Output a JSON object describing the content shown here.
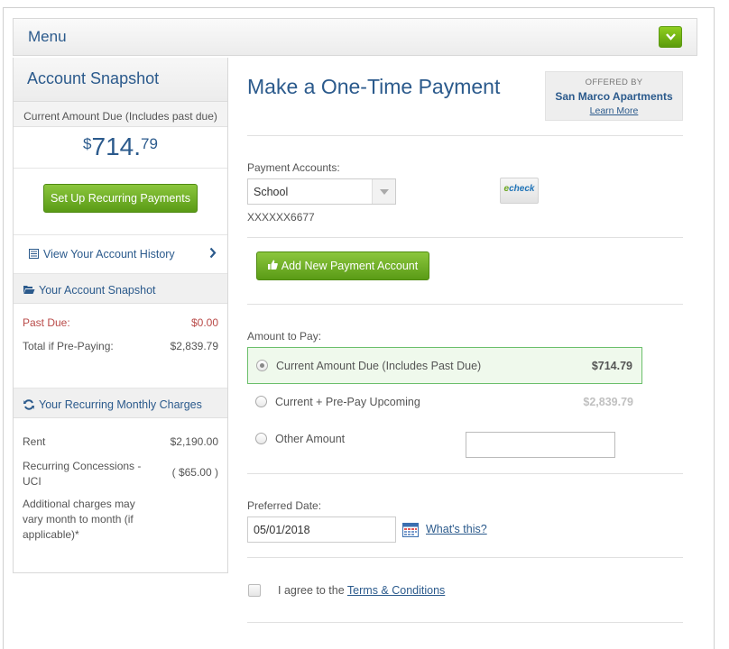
{
  "menu": {
    "title": "Menu"
  },
  "sidebar": {
    "title": "Account Snapshot",
    "current_due_label": "Current Amount Due (Includes past due)",
    "current_due": {
      "currency": "$",
      "dollars": "714",
      "dot": ".",
      "cents": "79"
    },
    "recurring_button": "Set Up Recurring Payments",
    "history_link": "View Your Account History",
    "snapshot_heading": "Your Account Snapshot",
    "snapshot_rows": [
      {
        "label": "Past Due:",
        "value": "$0.00"
      },
      {
        "label": "Total if Pre-Paying:",
        "value": "$2,839.79"
      }
    ],
    "charges_heading": "Your Recurring Monthly Charges",
    "charges": [
      {
        "label": "Rent",
        "value": "$2,190.00"
      },
      {
        "label_line1": "Recurring Concessions -",
        "label_line2": "UCI",
        "value": "( $65.00 )"
      }
    ],
    "charges_note": [
      "Additional charges may",
      "vary month to month (if",
      "applicable)*"
    ]
  },
  "main": {
    "title": "Make a One-Time Payment",
    "offered": {
      "by": "OFFERED BY",
      "property": "San Marco Apartments",
      "learn_more": "Learn More"
    },
    "payment_accounts_label": "Payment Accounts:",
    "payment_account_selected": "School",
    "account_number": "XXXXXX6677",
    "echeck": {
      "e": "e",
      "rest": "check"
    },
    "add_account_button": "Add New Payment Account",
    "amount_label": "Amount to Pay:",
    "options": [
      {
        "label": "Current Amount Due (Includes Past Due)",
        "amount": "$714.79",
        "selected": true
      },
      {
        "label": "Current + Pre-Pay Upcoming",
        "amount": "$2,839.79",
        "selected": false
      },
      {
        "label": "Other Amount",
        "amount": "",
        "selected": false
      }
    ],
    "preferred_date_label": "Preferred Date:",
    "preferred_date": "05/01/2018",
    "whats_this": "What's this?",
    "agree_text": "I agree to the",
    "terms_link": "Terms & Conditions"
  },
  "colors": {
    "brand_blue": "#2b5a8c",
    "green": "#6cab1f",
    "past_due_red": "#b94a48"
  }
}
